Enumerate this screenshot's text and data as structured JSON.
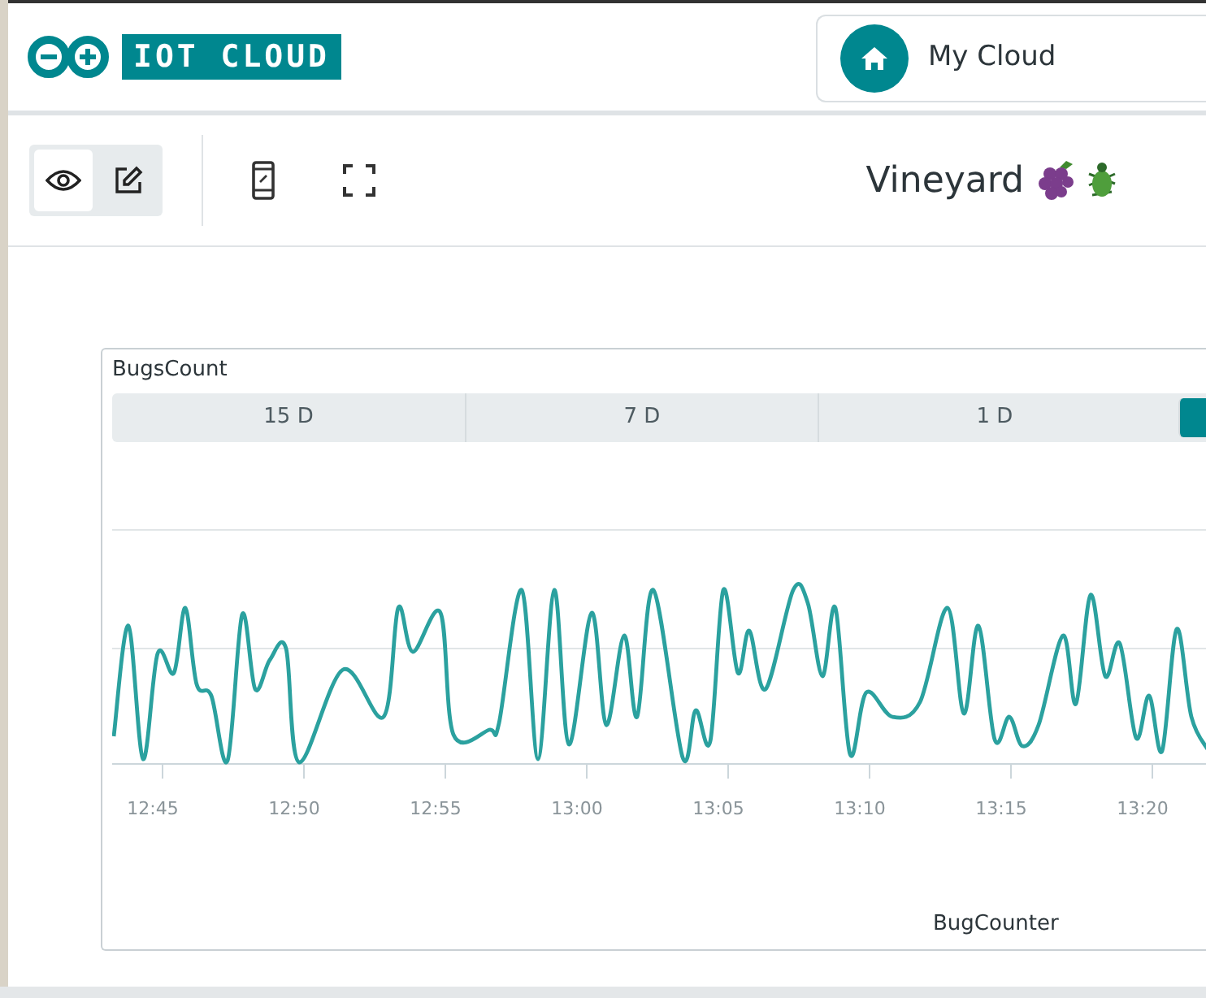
{
  "header": {
    "logo_text": "IOT CLOUD",
    "space_selector": "My Cloud"
  },
  "toolbar": {
    "modes": [
      {
        "kind": "view",
        "selected": true
      },
      {
        "kind": "edit",
        "selected": false
      }
    ],
    "dashboard_title": "Vineyard"
  },
  "widget": {
    "title": "BugsCount",
    "ranges": [
      {
        "label": "15 D",
        "selected": false
      },
      {
        "label": "7 D",
        "selected": false
      },
      {
        "label": "1 D",
        "selected": false
      },
      {
        "selected": true
      }
    ],
    "x_ticks": [
      "12:45",
      "12:50",
      "12:55",
      "13:00",
      "13:05",
      "13:10",
      "13:15",
      "13:20"
    ],
    "legend": "BugCounter"
  }
}
